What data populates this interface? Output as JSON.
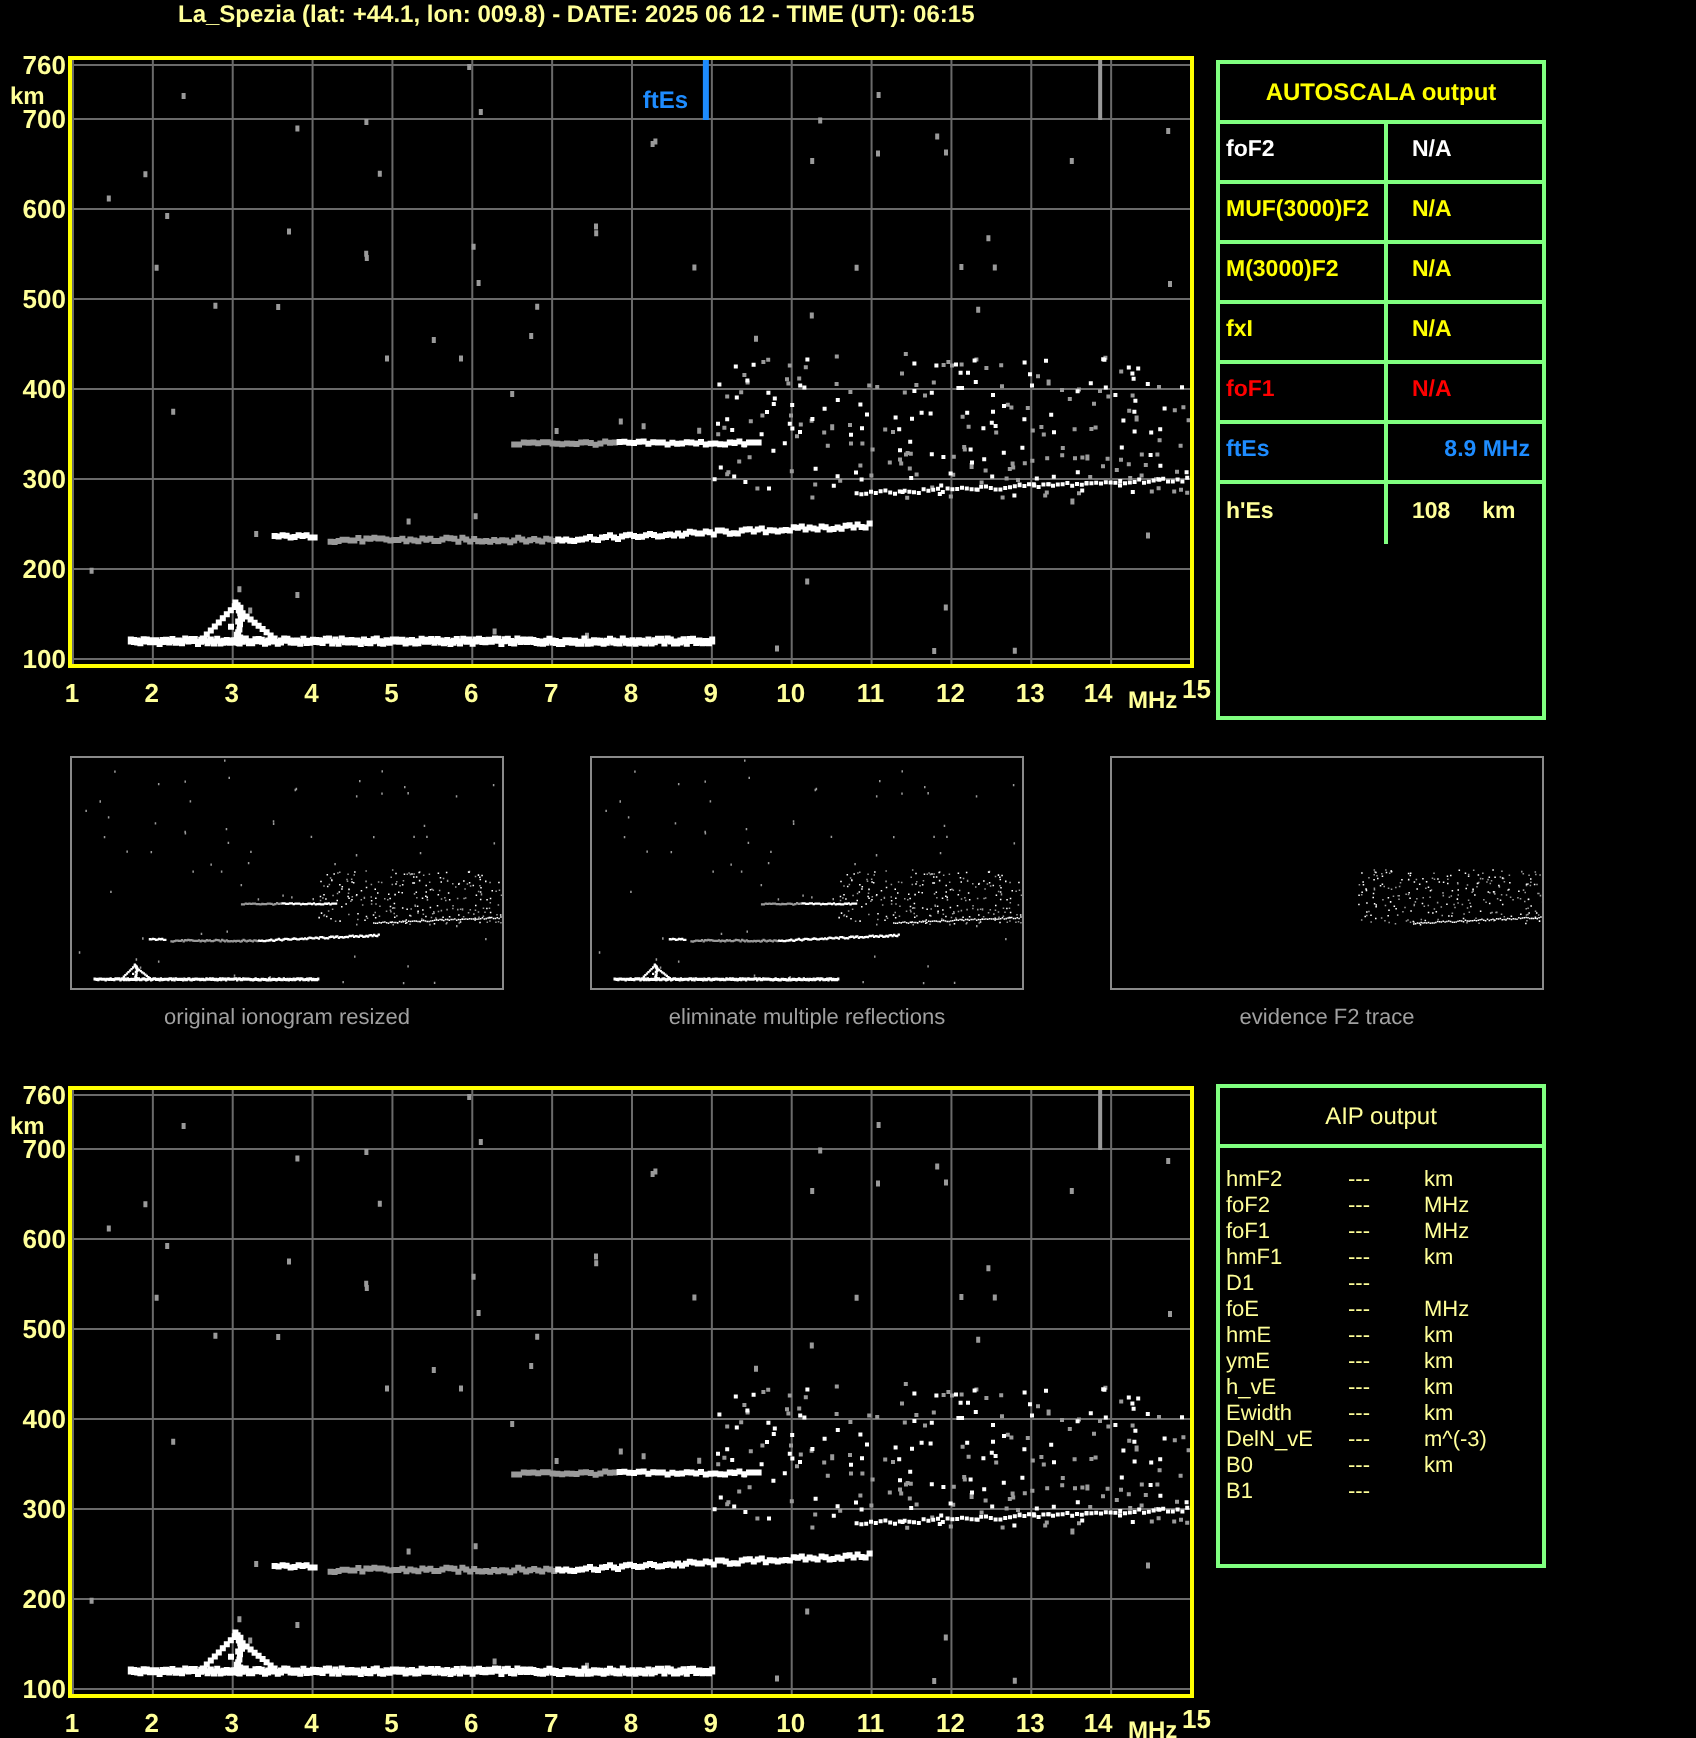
{
  "title": "La_Spezia (lat: +44.1, lon: 009.8) - DATE: 2025 06 12 - TIME (UT): 06:15",
  "ionogram_top": {
    "y_ticks": [
      "760",
      "700",
      "600",
      "500",
      "400",
      "300",
      "200",
      "100"
    ],
    "y_unit": "km",
    "x_ticks": [
      "1",
      "2",
      "3",
      "4",
      "5",
      "6",
      "7",
      "8",
      "9",
      "10",
      "11",
      "12",
      "13",
      "14",
      "15"
    ],
    "x_unit": "MHz",
    "marker_label": "ftEs"
  },
  "thumbnails": [
    {
      "caption": "original ionogram resized",
      "kind": "full"
    },
    {
      "caption": "eliminate multiple reflections",
      "kind": "full"
    },
    {
      "caption": "evidence F2 trace",
      "kind": "f2"
    }
  ],
  "autoscala": {
    "title": "AUTOSCALA output",
    "rows": [
      {
        "name": "foF2",
        "value": "N/A",
        "color": "#ffffff"
      },
      {
        "name": "MUF(3000)F2",
        "value": "N/A",
        "color": "#ffff00"
      },
      {
        "name": "M(3000)F2",
        "value": "N/A",
        "color": "#ffff00"
      },
      {
        "name": "fxI",
        "value": "N/A",
        "color": "#ffff00"
      },
      {
        "name": "foF1",
        "value": "N/A",
        "color": "#ff0000"
      },
      {
        "name": "ftEs",
        "value": "8.9 MHz",
        "color": "#1e8cff"
      },
      {
        "name": "h'Es",
        "value": "108     km",
        "color": "#ffff99"
      }
    ]
  },
  "ionogram_bottom": {
    "y_ticks": [
      "760",
      "700",
      "600",
      "500",
      "400",
      "300",
      "200",
      "100"
    ],
    "y_unit": "km",
    "x_ticks": [
      "1",
      "2",
      "3",
      "4",
      "5",
      "6",
      "7",
      "8",
      "9",
      "10",
      "11",
      "12",
      "13",
      "14",
      "15"
    ],
    "x_unit": "MHz"
  },
  "aip": {
    "title": "AIP output",
    "rows": [
      {
        "name": "hmF2",
        "value": "---",
        "unit": "km"
      },
      {
        "name": "foF2",
        "value": "---",
        "unit": "MHz"
      },
      {
        "name": "foF1",
        "value": "---",
        "unit": "MHz"
      },
      {
        "name": "hmF1",
        "value": "---",
        "unit": "km"
      },
      {
        "name": "D1",
        "value": "---"
      },
      {
        "name": "foE",
        "value": "---",
        "unit": "MHz"
      },
      {
        "name": "hmE",
        "value": "---",
        "unit": "km"
      },
      {
        "name": "ymE",
        "value": "---",
        "unit": "km"
      },
      {
        "name": "h_vE",
        "value": "---",
        "unit": "km"
      },
      {
        "name": "Ewidth",
        "value": "---",
        "unit": "km"
      },
      {
        "name": "DelN_vE",
        "value": "---",
        "unit": "m^(-3)"
      },
      {
        "name": "B0",
        "value": "---",
        "unit": "km"
      },
      {
        "name": "B1",
        "value": "---"
      }
    ]
  }
}
